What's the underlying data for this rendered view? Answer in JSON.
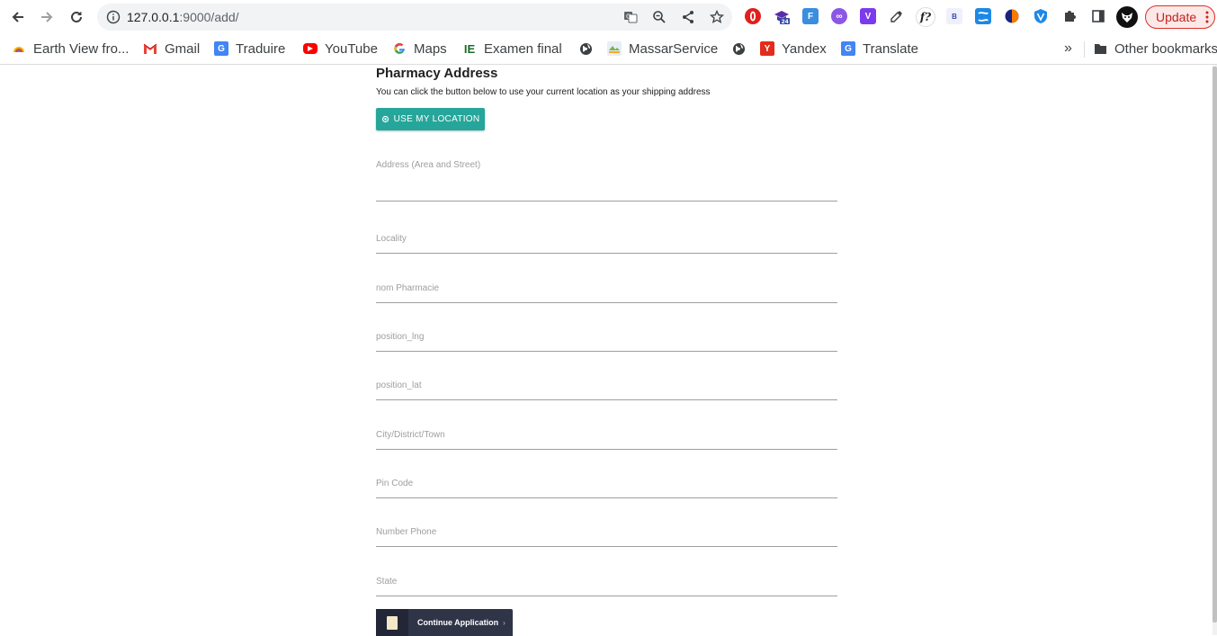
{
  "browser": {
    "url_host": "127.0.0.1",
    "url_path": ":9000/add/",
    "update_label": "Update",
    "extensions": [
      {
        "name": "opera-icon",
        "color": "#e0201c",
        "glyph": ""
      },
      {
        "name": "grad-cap-icon",
        "color": "#5b2ea6",
        "glyph": "",
        "badge": "24"
      },
      {
        "name": "f-extension-icon",
        "color": "#3b8de0",
        "glyph": "F"
      },
      {
        "name": "infinity-icon",
        "color": "#8b57e5",
        "glyph": "∞"
      },
      {
        "name": "v-extension-icon",
        "color": "#7c3aed",
        "glyph": "V"
      },
      {
        "name": "eyedropper-icon",
        "color": "#5f6368",
        "glyph": ""
      },
      {
        "name": "f-question-icon",
        "color": "#ffffff",
        "glyph": "f?"
      },
      {
        "name": "b-extension-icon",
        "color": "#eef0fb",
        "glyph": "B"
      },
      {
        "name": "s-extension-icon",
        "color": "#1e88e5",
        "glyph": ""
      },
      {
        "name": "orange-circle-icon",
        "color": "#f57c00",
        "glyph": ""
      },
      {
        "name": "shield-v-icon",
        "color": "#1e88e5",
        "glyph": ""
      }
    ]
  },
  "bookmarks": {
    "items": [
      {
        "label": "Earth View fro...",
        "icon": "earth-view-icon"
      },
      {
        "label": "Gmail",
        "icon": "gmail-icon"
      },
      {
        "label": "Traduire",
        "icon": "translate-icon"
      },
      {
        "label": "YouTube",
        "icon": "youtube-icon"
      },
      {
        "label": "Maps",
        "icon": "google-icon"
      },
      {
        "label": "Examen final",
        "icon": "ie-icon"
      },
      {
        "label": "",
        "icon": "globe-icon"
      },
      {
        "label": "MassarService",
        "icon": "massar-icon"
      },
      {
        "label": "",
        "icon": "globe-icon"
      },
      {
        "label": "Yandex",
        "icon": "yandex-icon"
      },
      {
        "label": "Translate",
        "icon": "translate-icon"
      }
    ],
    "other_label": "Other bookmarks",
    "overflow_glyph": "»"
  },
  "form": {
    "title": "Pharmacy Address",
    "subtitle": "You can click the button below to use your current location as your shipping address",
    "location_button": "USE MY LOCATION",
    "fields": {
      "address": "Address (Area and Street)",
      "locality": "Locality",
      "nom_pharmacie": "nom Pharmacie",
      "position_lng": "position_lng",
      "position_lat": "position_lat",
      "city": "City/District/Town",
      "pin_code": "Pin Code",
      "number_phone": "Number Phone",
      "state": "State"
    },
    "continue_button": "Continue Application",
    "continue_arrow": "›"
  },
  "colors": {
    "accent_teal": "#26a69a",
    "continue_dark": "#2f3447",
    "update_red": "#d93025"
  }
}
